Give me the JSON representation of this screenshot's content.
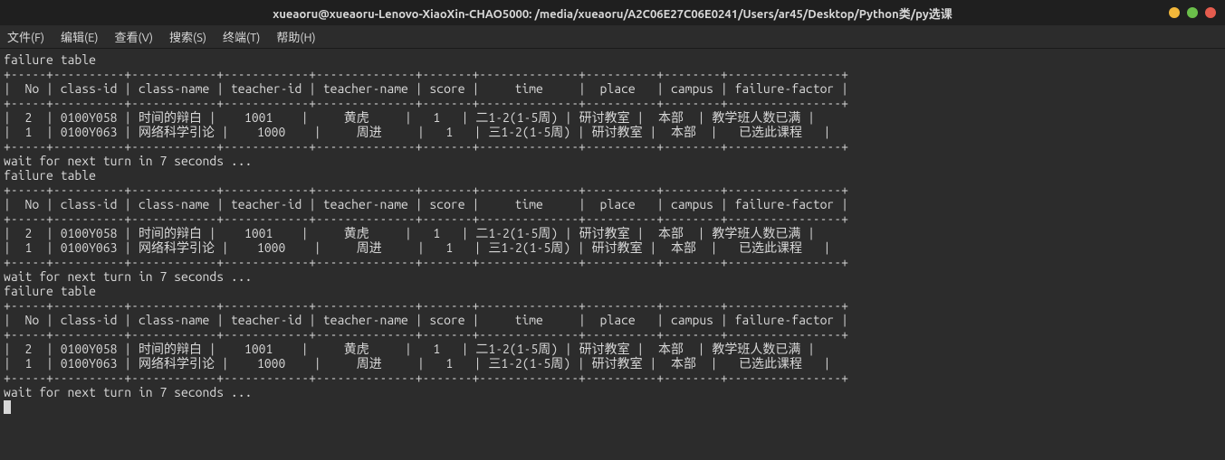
{
  "window": {
    "title": "xueaoru@xueaoru-Lenovo-XiaoXin-CHAO5000: /media/xueaoru/A2C06E27C06E0241/Users/ar45/Desktop/Python类/py选课"
  },
  "menu": {
    "file": "文件(F)",
    "edit": "编辑(E)",
    "view": "查看(V)",
    "search": "搜索(S)",
    "terminal": "终端(T)",
    "help": "帮助(H)"
  },
  "strings": {
    "failure_table": "failure table",
    "wait_msg": "wait for next turn in 7 seconds ..."
  },
  "table": {
    "sep": "+-----+----------+------------+------------+--------------+-------+--------------+----------+--------+----------------+",
    "header": "|  No | class-id | class-name | teacher-id | teacher-name | score |     time     |  place   | campus | failure-factor |",
    "row1": "|  2  | 0100Y058 | 时间的辩白 |    1001    |     黄虎     |   1   | 二1-2(1-5周) | 研讨教室 |  本部  | 教学班人数已满 |",
    "row2": "|  1  | 0100Y063 | 网络科学引论 |    1000    |     周进     |   1   | 三1-2(1-5周) | 研讨教室 |  本部  |   已选此课程   |"
  },
  "chart_data": {
    "type": "table",
    "title": "failure table",
    "columns": [
      "No",
      "class-id",
      "class-name",
      "teacher-id",
      "teacher-name",
      "score",
      "time",
      "place",
      "campus",
      "failure-factor"
    ],
    "rows": [
      {
        "No": "2",
        "class-id": "0100Y058",
        "class-name": "时间的辩白",
        "teacher-id": "1001",
        "teacher-name": "黄虎",
        "score": "1",
        "time": "二1-2(1-5周)",
        "place": "研讨教室",
        "campus": "本部",
        "failure-factor": "教学班人数已满"
      },
      {
        "No": "1",
        "class-id": "0100Y063",
        "class-name": "网络科学引论",
        "teacher-id": "1000",
        "teacher-name": "周进",
        "score": "1",
        "time": "三1-2(1-5周)",
        "place": "研讨教室",
        "campus": "本部",
        "failure-factor": "已选此课程"
      }
    ],
    "repeats": 3,
    "wait_message": "wait for next turn in 7 seconds ..."
  }
}
